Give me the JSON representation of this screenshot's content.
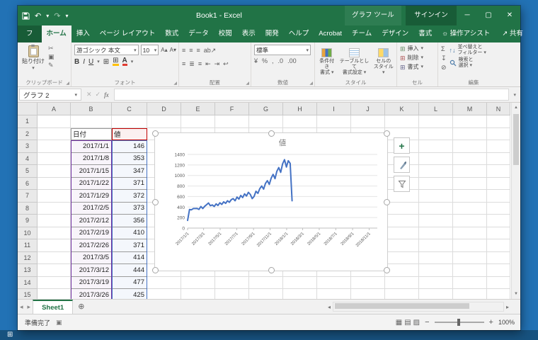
{
  "colors": {
    "excel_green": "#217346",
    "range_categories": "#7030a0",
    "range_values": "#4472c4",
    "range_name": "#c00000",
    "series_line": "#4472c4"
  },
  "titlebar": {
    "title": "Book1  -  Excel",
    "context_title": "グラフ ツール",
    "signin_label": "サインイン"
  },
  "icons": {
    "undo": "↶",
    "redo": "↷",
    "chevron_down": "▾",
    "minimize": "─",
    "maximize": "▢",
    "close": "✕",
    "cut": "✂",
    "copy": "▣",
    "format_painter": "✎",
    "font_increase": "A▴",
    "font_decrease": "A▾",
    "borders": "⊞",
    "align_row1_0": "≡",
    "align_row1_1": "≡",
    "align_row1_2": "≡",
    "align_row1_3": "ab↗",
    "align_row2_0": "≡",
    "align_row2_1": "≣",
    "align_row2_2": "≡",
    "align_row2_3": "⇤",
    "align_row2_4": "⇥",
    "align_row2_5": "↩",
    "currency": "¥",
    "percent": "%",
    "comma": ",",
    "dec_inc": ".0",
    "dec_dec": ".00",
    "sigma": "Σ",
    "fill_down": "↧",
    "clear": "⊘",
    "sort": "↑↓",
    "bulb": "☼",
    "share": "↗",
    "launcher": "◢",
    "sheet_prev": "◂",
    "sheet_next": "▸",
    "add_sheet": "⊕",
    "scroll_up": "▲",
    "scroll_down": "▼",
    "scroll_left": "◂",
    "scroll_right": "▸",
    "view_normal": "▦",
    "view_layout": "▤",
    "view_break": "▨",
    "zoom_out": "−",
    "zoom_in": "+",
    "record_macro": "▣",
    "start": "⊞",
    "chart_add": "+"
  },
  "ribbon_tabs": {
    "file": "ファイル",
    "main": [
      "ホーム",
      "挿入",
      "ページ レイアウト",
      "数式",
      "データ",
      "校閲",
      "表示",
      "開発",
      "ヘルプ",
      "Acrobat",
      "チーム"
    ],
    "contextual": [
      "デザイン",
      "書式"
    ],
    "active": "ホーム",
    "tell_me": "操作アシスト",
    "share": "共有"
  },
  "ribbon": {
    "clipboard": {
      "label": "クリップボード",
      "paste": "貼り付け"
    },
    "font": {
      "label": "フォント",
      "name": "游ゴシック 本文",
      "size": "10",
      "bold": "B",
      "italic": "I",
      "underline": "U"
    },
    "alignment": {
      "label": "配置"
    },
    "number": {
      "label": "数値",
      "format": "標準"
    },
    "styles": {
      "label": "スタイル",
      "conditional_1": "条件付き",
      "conditional_2": "書式",
      "format_table_1": "テーブルとして",
      "format_table_2": "書式設定",
      "cell_styles_1": "セルの",
      "cell_styles_2": "スタイル"
    },
    "cells": {
      "label": "セル",
      "insert": "挿入",
      "delete": "削除",
      "format": "書式"
    },
    "editing": {
      "label": "編集",
      "sort_1": "並べ替えと",
      "sort_2": "フィルター",
      "find_1": "検索と",
      "find_2": "選択"
    }
  },
  "formula_bar": {
    "name_box": "グラフ 2",
    "cancel": "✕",
    "enter": "✓",
    "fx": "fx",
    "value": ""
  },
  "sheet": {
    "columns": [
      "A",
      "B",
      "C",
      "D",
      "E",
      "F",
      "G",
      "H",
      "I",
      "J",
      "K",
      "L",
      "M",
      "N"
    ],
    "row_count": 15,
    "table": {
      "origin": "B2",
      "header": [
        "日付",
        "値"
      ],
      "rows": [
        [
          "2017/1/1",
          "146"
        ],
        [
          "2017/1/8",
          "353"
        ],
        [
          "2017/1/15",
          "347"
        ],
        [
          "2017/1/22",
          "371"
        ],
        [
          "2017/1/29",
          "372"
        ],
        [
          "2017/2/5",
          "373"
        ],
        [
          "2017/2/12",
          "356"
        ],
        [
          "2017/2/19",
          "410"
        ],
        [
          "2017/2/26",
          "371"
        ],
        [
          "2017/3/5",
          "414"
        ],
        [
          "2017/3/12",
          "444"
        ],
        [
          "2017/3/19",
          "477"
        ],
        [
          "2017/3/26",
          "425"
        ]
      ]
    }
  },
  "chart_data": {
    "type": "line",
    "title": "値",
    "x_range": [
      "2017/1/1",
      "2018/12/1"
    ],
    "x_ticks": [
      "2017/1/1",
      "2017/3/1",
      "2017/5/1",
      "2017/7/1",
      "2017/9/1",
      "2017/11/1",
      "2018/1/1",
      "2018/3/1",
      "2018/5/1",
      "2018/7/1",
      "2018/9/1",
      "2018/11/1"
    ],
    "y_ticks": [
      0,
      200,
      400,
      600,
      800,
      1000,
      1200,
      1400
    ],
    "ylim": [
      0,
      1400
    ],
    "grid": true,
    "legend": "none",
    "series": [
      {
        "name": "値",
        "color": "#4472c4",
        "start_date": "2017/1/1",
        "interval_days": 7,
        "values": [
          146,
          353,
          347,
          371,
          372,
          373,
          356,
          410,
          371,
          414,
          444,
          477,
          425,
          440,
          410,
          460,
          430,
          480,
          450,
          500,
          470,
          520,
          490,
          540,
          560,
          520,
          590,
          550,
          620,
          580,
          650,
          610,
          680,
          640,
          560,
          600,
          700,
          660,
          750,
          800,
          740,
          850,
          900,
          830,
          950,
          1020,
          940,
          1080,
          1150,
          1060,
          1220,
          1300,
          1160,
          1280,
          1230,
          520
        ]
      }
    ]
  },
  "sheet_bar": {
    "active_tab": "Sheet1"
  },
  "status_bar": {
    "ready": "準備完了",
    "zoom_level": "100%"
  }
}
